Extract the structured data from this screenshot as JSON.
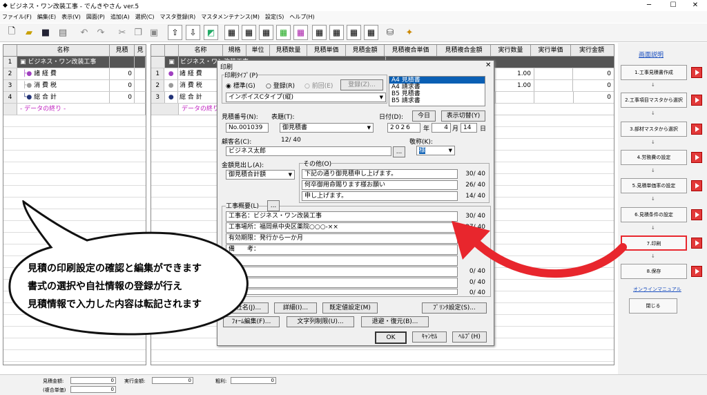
{
  "window": {
    "title": "ビジネス・ワン改装工事 - でんきやさん ver.5",
    "min": "─",
    "max": "☐",
    "close": "✕"
  },
  "menu": [
    "ファイル(F)",
    "編集(E)",
    "表示(V)",
    "図面(P)",
    "追加(A)",
    "選択(C)",
    "マスタ登録(R)",
    "マスタメンテナンス(M)",
    "設定(S)",
    "ヘルプ(H)"
  ],
  "left_grid": {
    "headers": [
      "名称",
      "見積",
      "見"
    ],
    "rows": [
      {
        "num": "1",
        "name": "ビジネス・ワン改装工事",
        "v": "",
        "w": ""
      },
      {
        "num": "2",
        "name": "諸 経 費",
        "v": "0",
        "w": ""
      },
      {
        "num": "3",
        "name": "消 費 税",
        "v": "0",
        "w": ""
      },
      {
        "num": "4",
        "name": "総 合 計",
        "v": "0",
        "w": ""
      }
    ],
    "end": "- データの終り -"
  },
  "right_grid": {
    "headers": [
      "名称",
      "規格",
      "単位",
      "見積数量",
      "見積単価",
      "見積金額",
      "見積複合単価",
      "見積複合金額",
      "実行数量",
      "実行単価",
      "実行金額"
    ],
    "rows": [
      {
        "num": "",
        "name": "ビジネス・ワン改装工事",
        "qty": "",
        "amt": ""
      },
      {
        "num": "1",
        "name": "諸 経 費",
        "qty": "1.00",
        "amt": "0"
      },
      {
        "num": "2",
        "name": "消 費 税",
        "qty": "1.00",
        "amt": "0"
      },
      {
        "num": "3",
        "name": "総 合 計",
        "qty": "",
        "amt": "0"
      }
    ],
    "end": "データの終り"
  },
  "dialog": {
    "title": "印刷",
    "close": "✕",
    "print_type_label": "印刷ﾀｲﾌﾟ(P)",
    "radio1": "標準(G)",
    "radio2": "登録(R)",
    "radio3": "前回(E)",
    "reg_btn": "登録(Z)...",
    "type_select": "インボイスCタイプ(縦)",
    "list": [
      "A4 見積書",
      "A4 請求書",
      "B5 見積書",
      "B5 請求書"
    ],
    "est_no_label": "見積番号(N):",
    "est_no": "No.001039",
    "title_label": "表題(T):",
    "title_value": "御見積書",
    "date_label": "日付(D):",
    "today_btn": "今日",
    "toggle_btn": "表示切替(Y)",
    "year": "2026",
    "year_unit": "年",
    "month": "4",
    "month_unit": "月",
    "day": "14",
    "day_unit": "日",
    "customer_label": "顧客名(C):",
    "customer_count": "12/ 40",
    "customer": "ビジネス太郎",
    "customer_btn": "...",
    "honorific_label": "敬称(K):",
    "honorific": "様",
    "amount_label": "金額見出し(A):",
    "amount": "御見積合計額",
    "other_label": "その他(O)",
    "other": [
      {
        "text": "下記の通り御見積申し上げます。",
        "count": "30/ 40"
      },
      {
        "text": "何卒御用命賜ります様お願い",
        "count": "26/ 40"
      },
      {
        "text": "申し上げます。",
        "count": "14/ 40"
      }
    ],
    "summary_label": "工事概要(L)",
    "summary_btn": "...",
    "summary": [
      {
        "text": "工事名：ビジネス・ワン改装工事",
        "count": "30/ 40"
      },
      {
        "text": "工事場所：福岡県中央区薬院○○○-××",
        "count": "37/ 40"
      },
      {
        "text": "有効期限：発行から一か月",
        "count": ""
      },
      {
        "text": "備　　考：",
        "count": ""
      },
      {
        "text": "",
        "count": ""
      },
      {
        "text": "",
        "count": "0/ 40"
      },
      {
        "text": "",
        "count": "0/ 40"
      },
      {
        "text": "",
        "count": "0/ 40"
      }
    ],
    "btn_name": "社名(J)...",
    "btn_detail": "詳細(I)...",
    "btn_default": "既定値設定(M)",
    "btn_printer": "ﾌﾟﾘﾝﾀ設定(S)...",
    "btn_form": "ﾌｫｰﾑ編集(F)...",
    "btn_strlimit": "文字列制限(U)...",
    "btn_backup": "退避・復元(B)...",
    "btn_ok": "OK",
    "btn_cancel": "ｷｬﾝｾﾙ",
    "btn_help": "ﾍﾙﾌﾟ(H)"
  },
  "panel": {
    "title": "画面説明",
    "steps": [
      "1.工事見積書作成",
      "2.工事項目マスタから選択",
      "3.部材マスタから選択",
      "4.労務費の設定",
      "5.見積単価率の設定",
      "6.見積条件の設定",
      "7.印刷",
      "8.保存"
    ],
    "arrow": "↓",
    "manual": "オンラインマニュアル",
    "close": "閉じる"
  },
  "status": {
    "est_label": "見積金額:",
    "est": "0",
    "exec_label": "実行金額:",
    "exec": "0",
    "profit_label": "粗利:",
    "profit": "0",
    "comp_label": "(複合単価)",
    "comp": "0"
  },
  "bubble": {
    "lines": [
      "見積の印刷設定の確認と編集ができます",
      "書式の選択や自社情報の登録が行え",
      "見積情報で入力した内容は転記されます"
    ]
  },
  "colors": {
    "accent": "#e8262d",
    "selected": "#0a5fb4",
    "header": "#4a4a4a"
  }
}
